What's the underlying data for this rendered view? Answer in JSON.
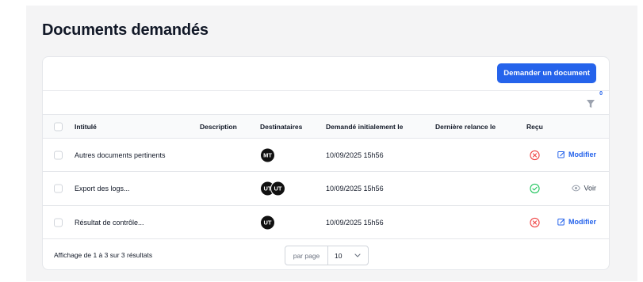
{
  "page": {
    "title": "Documents demandés"
  },
  "toolbar": {
    "request_button": "Demander un document"
  },
  "filter": {
    "count": "0"
  },
  "table": {
    "columns": {
      "title": "Intitulé",
      "description": "Description",
      "recipients": "Destinataires",
      "requested": "Demandé initialement le",
      "last_reminder": "Dernière relance le",
      "received": "Reçu"
    },
    "rows": [
      {
        "title": "Autres documents pertinents",
        "description": "",
        "recipients": [
          "MT"
        ],
        "requested": "10/09/2025 15h56",
        "last_reminder": "",
        "received": "no",
        "action": "Modifier"
      },
      {
        "title": "Export des logs...",
        "description": "",
        "recipients": [
          "UT",
          "UT"
        ],
        "requested": "10/09/2025 15h56",
        "last_reminder": "",
        "received": "yes",
        "action": "Voir"
      },
      {
        "title": "Résultat de contrôle...",
        "description": "",
        "recipients": [
          "UT"
        ],
        "requested": "10/09/2025 15h56",
        "last_reminder": "",
        "received": "no",
        "action": "Modifier"
      }
    ]
  },
  "footer": {
    "summary": "Affichage de 1 à 3 sur 3 résultats",
    "per_page_label": "par page",
    "per_page_value": "10"
  },
  "colors": {
    "accent": "#2563eb",
    "status_no": "#ef4444",
    "status_yes": "#22c55e",
    "avatar": "#111111"
  },
  "icons": {
    "filter": "filter-icon",
    "status_no": "x-circle-icon",
    "status_yes": "check-circle-icon",
    "edit": "edit-icon",
    "view": "eye-icon",
    "dropdown": "chevron-down-icon"
  }
}
